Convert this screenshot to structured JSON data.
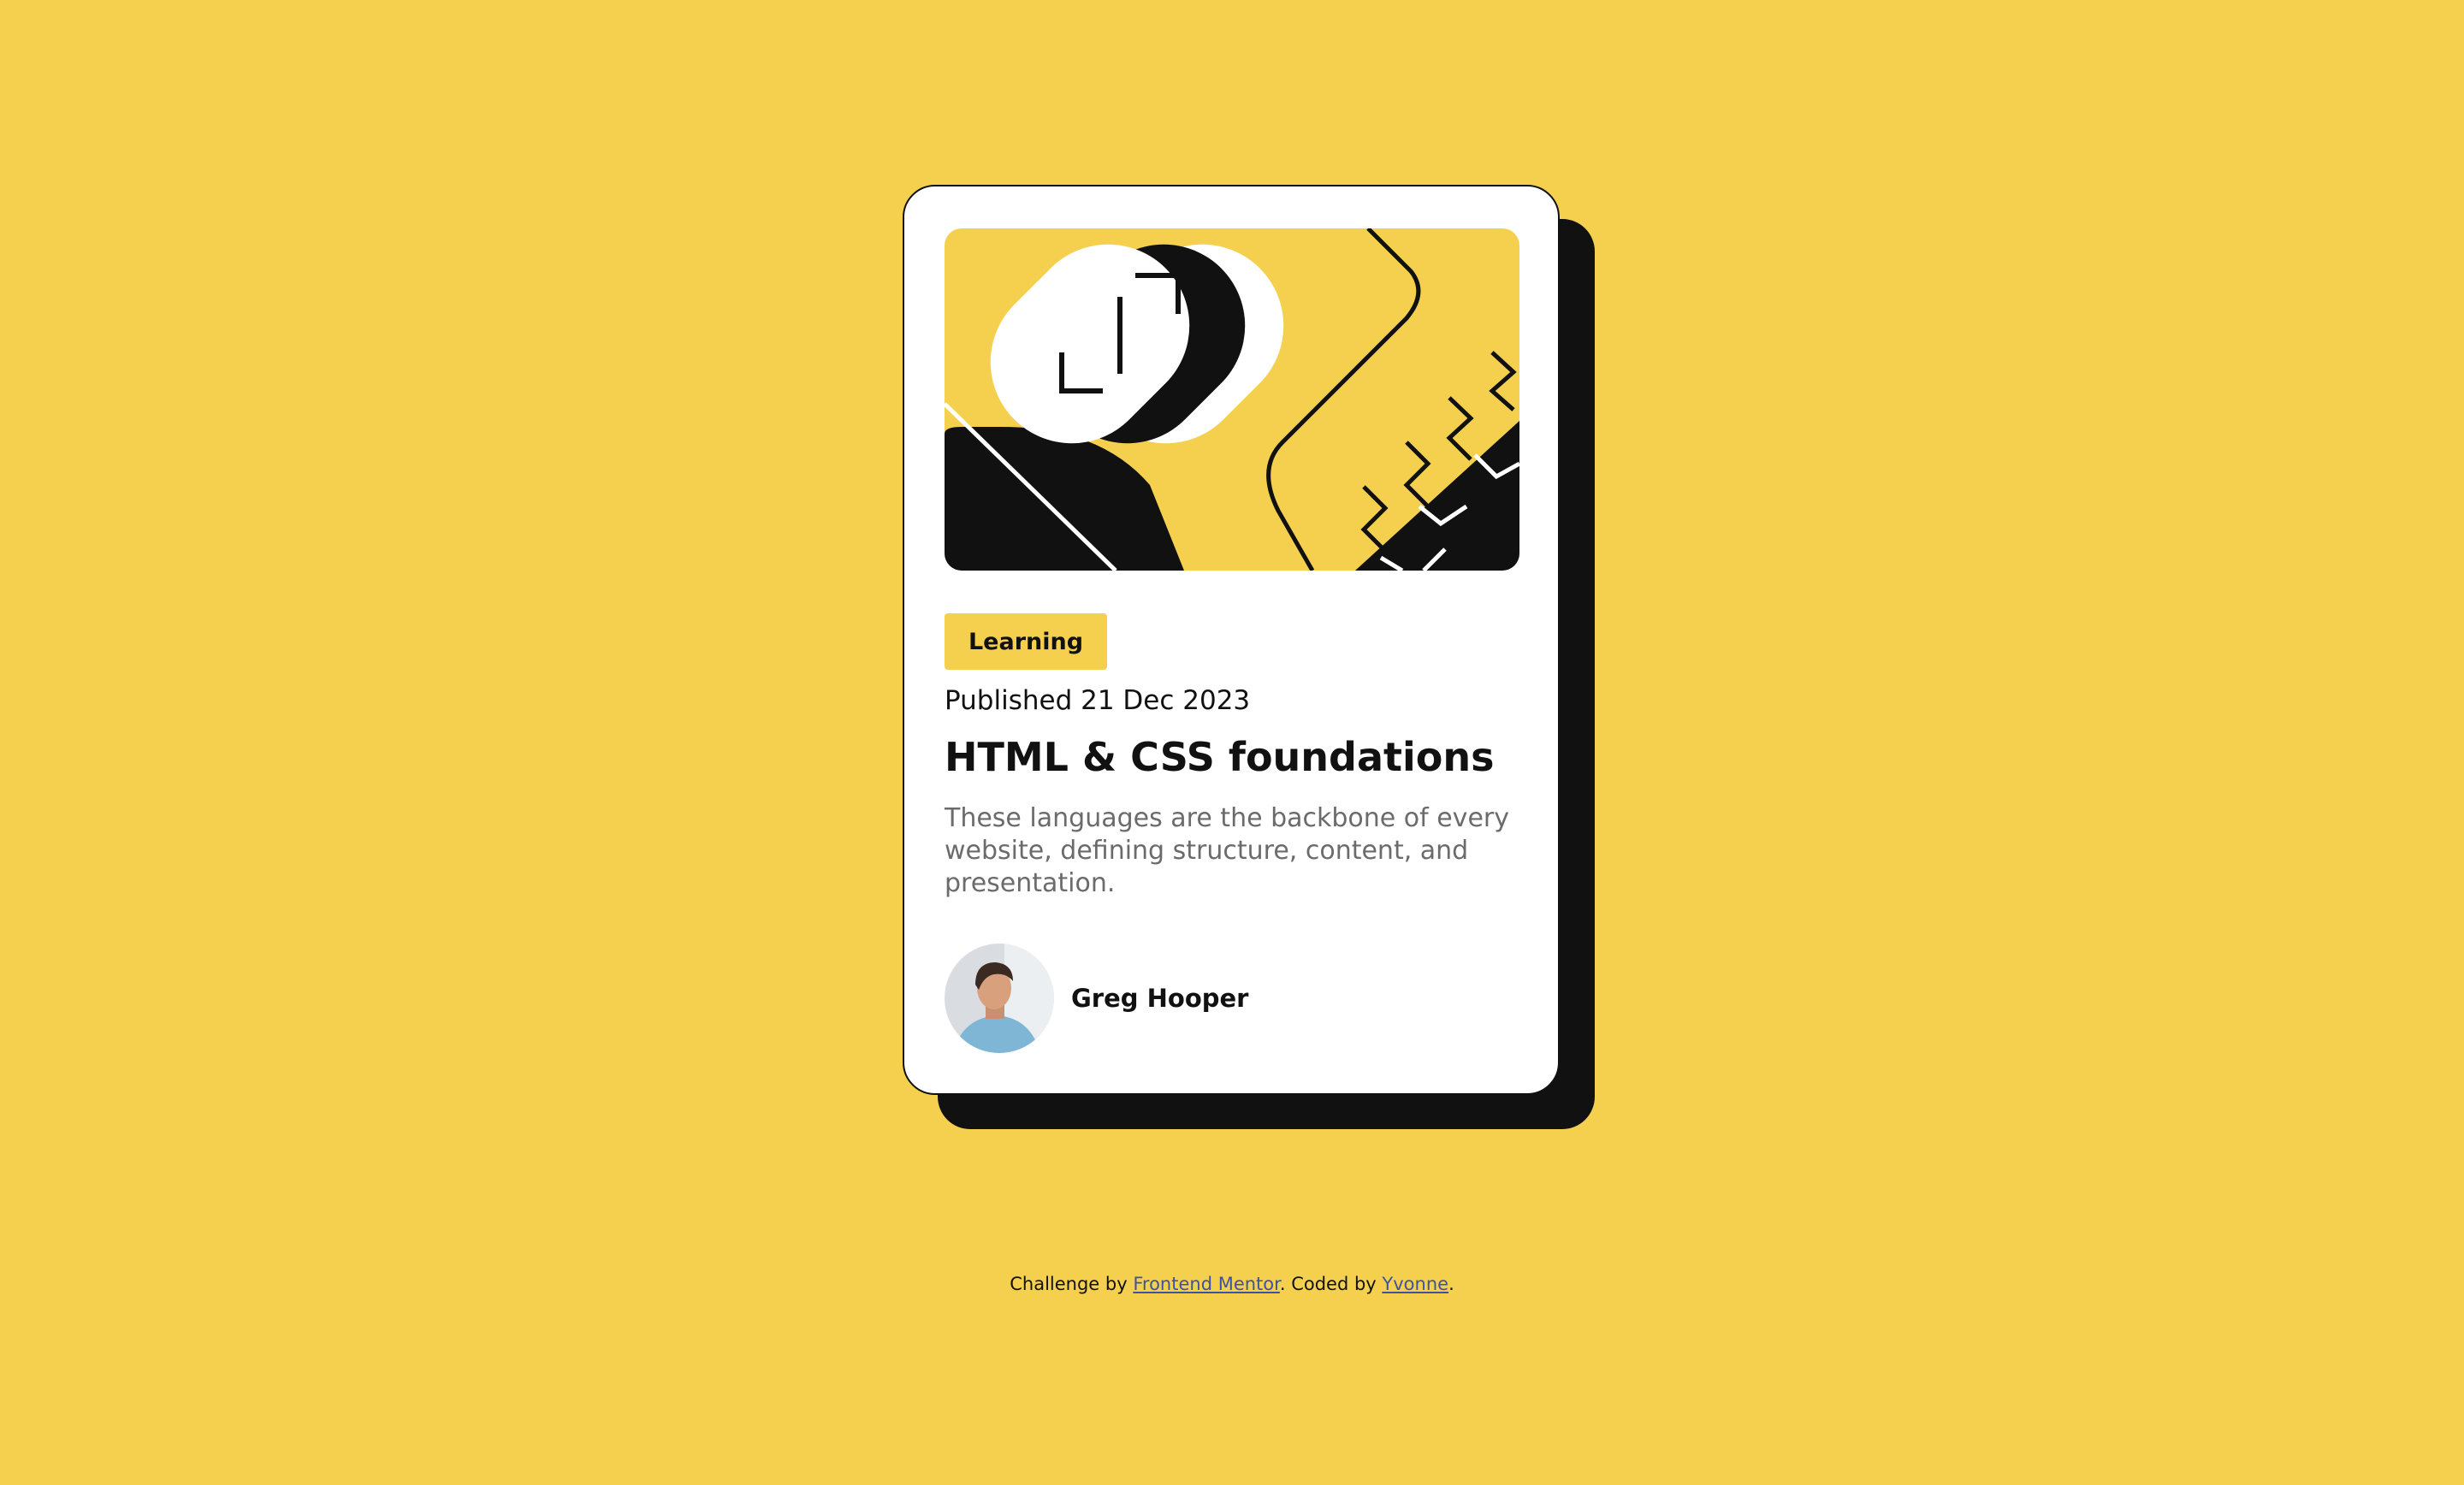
{
  "card": {
    "tag": "Learning",
    "published": "Published 21 Dec 2023",
    "title": "HTML & CSS foundations",
    "description": "These languages are the backbone of every website, defining structure, content, and presentation.",
    "author": {
      "name": "Greg Hooper"
    },
    "hero_icon": "code-brackets-illustration-icon"
  },
  "attribution": {
    "prefix": "Challenge by ",
    "challenge_link": "Frontend Mentor",
    "middle": ". Coded by ",
    "coder_link": "Yvonne",
    "suffix": "."
  },
  "colors": {
    "background": "#f4d04e",
    "ink": "#111111",
    "card": "#ffffff",
    "muted_text": "#6b6b6b",
    "link": "#3e52a3"
  }
}
